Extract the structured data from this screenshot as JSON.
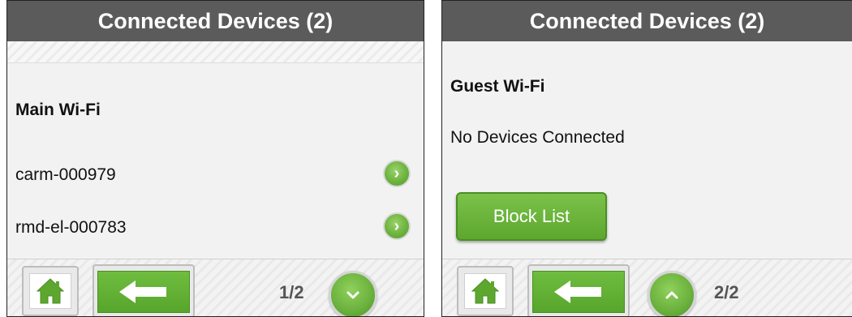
{
  "screens": [
    {
      "header_title": "Connected Devices (2)",
      "section_title": "Main Wi-Fi",
      "devices": [
        {
          "name": "carm-000979",
          "action_icon": "chevron-right-icon"
        },
        {
          "name": "rmd-el-000783",
          "action_icon": "chevron-right-icon"
        }
      ],
      "footer": {
        "home_icon": "home-icon",
        "back_icon": "arrow-left-icon",
        "page_indicator": "1/2",
        "scroll_icon": "chevron-down-icon"
      }
    },
    {
      "header_title": "Connected Devices (2)",
      "section_title": "Guest Wi-Fi",
      "status_text": "No Devices Connected",
      "block_list_label": "Block List",
      "footer": {
        "home_icon": "home-icon",
        "back_icon": "arrow-left-icon",
        "page_indicator": "2/2",
        "scroll_icon": "chevron-up-icon"
      }
    }
  ],
  "colors": {
    "header_bg": "#5b5b5b",
    "accent_green": "#6db33f",
    "panel_bg": "#f2f2f2"
  }
}
